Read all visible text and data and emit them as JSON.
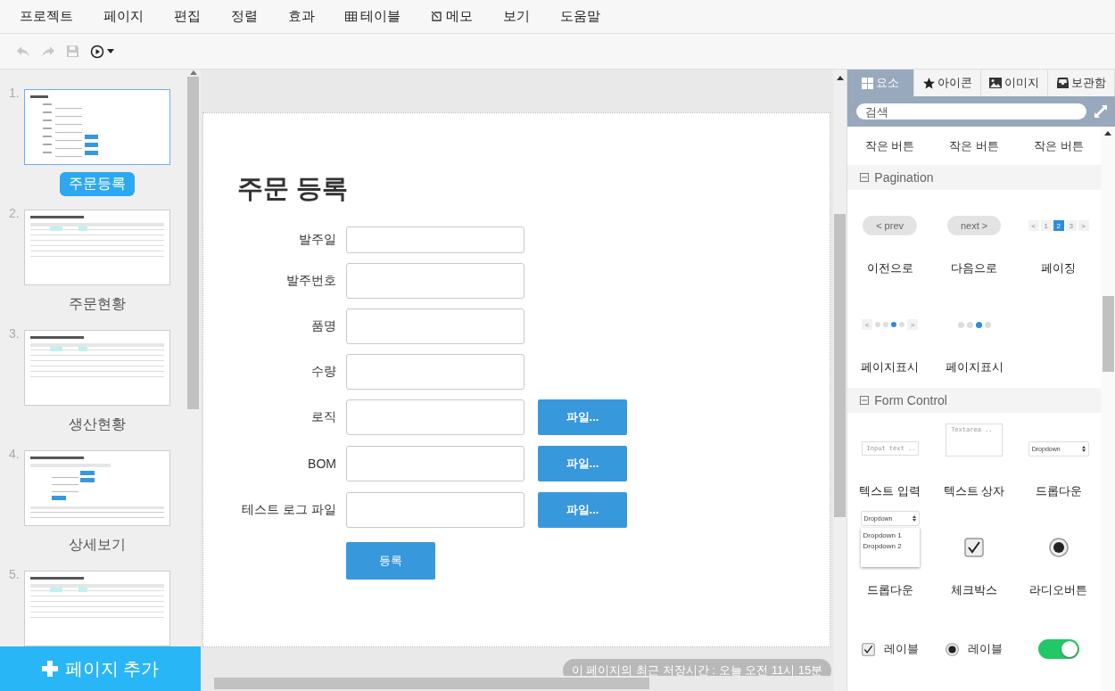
{
  "menu": [
    {
      "label": "프로젝트"
    },
    {
      "label": "페이지"
    },
    {
      "label": "편집"
    },
    {
      "label": "정렬"
    },
    {
      "label": "효과"
    },
    {
      "label": "테이블",
      "kind": "table"
    },
    {
      "label": "메모",
      "kind": "memo"
    },
    {
      "label": "보기"
    },
    {
      "label": "도움말"
    }
  ],
  "toolbar": [
    {
      "kind": "undo",
      "disabled": true
    },
    {
      "kind": "redo",
      "disabled": true
    },
    {
      "kind": "save",
      "disabled": true
    },
    {
      "kind": "play",
      "disabled": false
    }
  ],
  "pages": [
    {
      "number": "1.",
      "title": "주문등록",
      "selected": true,
      "kind": "form"
    },
    {
      "number": "2.",
      "title": "주문현황",
      "selected": false,
      "kind": "list"
    },
    {
      "number": "3.",
      "title": "생산현황",
      "selected": false,
      "kind": "table"
    },
    {
      "number": "4.",
      "title": "상세보기",
      "selected": false,
      "kind": "detail"
    },
    {
      "number": "5.",
      "selected": false,
      "kind": "table"
    }
  ],
  "add_page": {
    "label": "페이지 추가"
  },
  "form": {
    "title": "주문 등록",
    "fields": [
      {
        "label": "발주일",
        "kind": "short"
      },
      {
        "label": "발주번호",
        "kind": "text"
      },
      {
        "label": "품명",
        "kind": "text"
      },
      {
        "label": "수량",
        "kind": "text"
      },
      {
        "label": "로직",
        "kind": "file",
        "button": "파일..."
      },
      {
        "label": "BOM",
        "kind": "file",
        "button": "파일..."
      },
      {
        "label": "테스트 로그 파일",
        "kind": "file",
        "button": "파일..."
      }
    ],
    "submit": "등록"
  },
  "save_toast": "이 페이지의 최근 저장시간 : 오늘 오전 11시 15분",
  "palette": {
    "tabs": [
      {
        "label": "요소",
        "kind": "grid",
        "selected": true
      },
      {
        "label": "아이콘",
        "kind": "star",
        "selected": false
      },
      {
        "label": "이미지",
        "kind": "image",
        "selected": false
      },
      {
        "label": "보관함",
        "kind": "inbox",
        "selected": false
      }
    ],
    "search": {
      "placeholder": "검색"
    },
    "top_items": [
      {
        "label": "작은 버튼"
      },
      {
        "label": "작은 버튼"
      },
      {
        "label": "작은 버튼"
      }
    ],
    "sections": [
      {
        "title": "Pagination",
        "expanded": true,
        "items": [
          {
            "kind": "pill",
            "text": "< prev",
            "label": "이전으로"
          },
          {
            "kind": "pill",
            "text": "next >",
            "label": "다음으로"
          },
          {
            "kind": "pager",
            "pages": [
              {
                "label": "<",
                "selected": false
              },
              {
                "label": "1",
                "selected": false
              },
              {
                "label": "2",
                "selected": true
              },
              {
                "label": "3",
                "selected": false
              },
              {
                "label": ">",
                "selected": false
              }
            ],
            "label": "페이징"
          },
          {
            "kind": "dot-pager",
            "prev": "<",
            "next": ">",
            "dots": [
              {
                "selected": false
              },
              {
                "selected": false
              },
              {
                "selected": true
              },
              {
                "selected": false
              }
            ],
            "label": "페이지표시"
          },
          {
            "kind": "dots",
            "dots": [
              {
                "selected": false
              },
              {
                "selected": false
              },
              {
                "selected": true
              },
              {
                "selected": false
              }
            ],
            "label": "페이지표시"
          }
        ]
      },
      {
        "title": "Form Control",
        "expanded": true,
        "items": [
          {
            "kind": "text-input",
            "placeholder": "Input text ..",
            "label": "텍스트 입력"
          },
          {
            "kind": "textarea",
            "placeholder": "Textarea ..",
            "label": "텍스트 상자"
          },
          {
            "kind": "dropdown",
            "value": "Dropdown",
            "label": "드롭다운"
          },
          {
            "kind": "dropdown-open",
            "value": "Dropdown",
            "options": [
              "Dropdown 1",
              "Dropdown 2"
            ],
            "label": "드롭다운"
          },
          {
            "kind": "checkbox",
            "checked": true,
            "label": "체크박스"
          },
          {
            "kind": "radio",
            "selected": true,
            "label": "라디오버튼"
          },
          {
            "kind": "checkbox-label",
            "checked": true,
            "text": "레이블"
          },
          {
            "kind": "radio-label",
            "selected": true,
            "text": "레이블"
          },
          {
            "kind": "toggle",
            "on": true
          }
        ]
      }
    ]
  }
}
